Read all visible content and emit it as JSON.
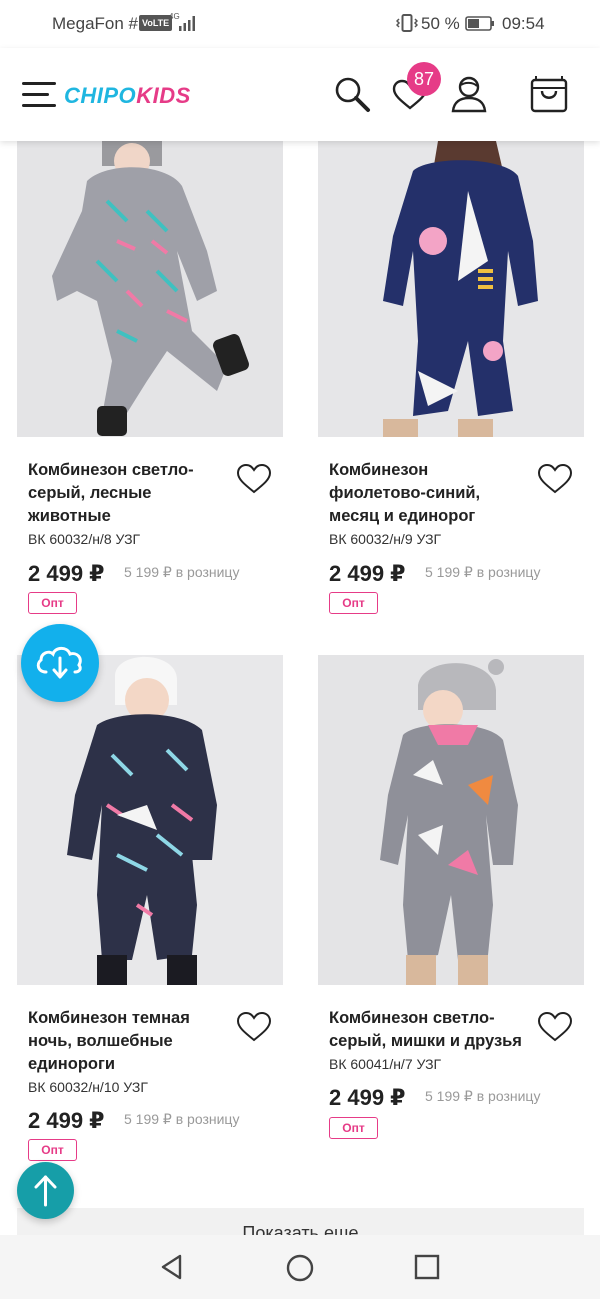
{
  "status_bar": {
    "carrier": "MegaFon #1",
    "volte": "VoLTE",
    "network": "4G",
    "battery": "50 %",
    "time": "09:54"
  },
  "header": {
    "logo_part1": "CHIPO",
    "logo_part2": "KIDS",
    "favorites_count": "87",
    "icons": [
      "menu-icon",
      "search-icon",
      "heart-icon",
      "user-icon",
      "cart-icon"
    ]
  },
  "colors": {
    "brand_blue": "#1fb6e0",
    "brand_pink": "#e63b87",
    "download_fab": "#12b0ec",
    "scroll_top_fab": "#169ea8"
  },
  "products": [
    {
      "title": "Комбинезон светло-серый, лесные животные",
      "sku": "ВК 60032/н/8 УЗГ",
      "price": "2 499 ₽",
      "retail": "5 199 ₽ в розницу",
      "badge": "Опт"
    },
    {
      "title": "Комбинезон фиолетово-синий, месяц и единорог",
      "sku": "ВК 60032/н/9 УЗГ",
      "price": "2 499 ₽",
      "retail": "5 199 ₽ в розницу",
      "badge": "Опт"
    },
    {
      "title": "Комбинезон темная ночь, волшебные единороги",
      "sku": "ВК 60032/н/10 УЗГ",
      "price": "2 499 ₽",
      "retail": "5 199 ₽ в розницу",
      "badge": "Опт"
    },
    {
      "title": "Комбинезон светло-серый, мишки и друзья",
      "sku": "ВК 60041/н/7 УЗГ",
      "price": "2 499 ₽",
      "retail": "5 199 ₽ в розницу",
      "badge": "Опт"
    }
  ],
  "show_more": "Показать еще",
  "nav": [
    "back-icon",
    "home-icon",
    "recents-icon"
  ]
}
